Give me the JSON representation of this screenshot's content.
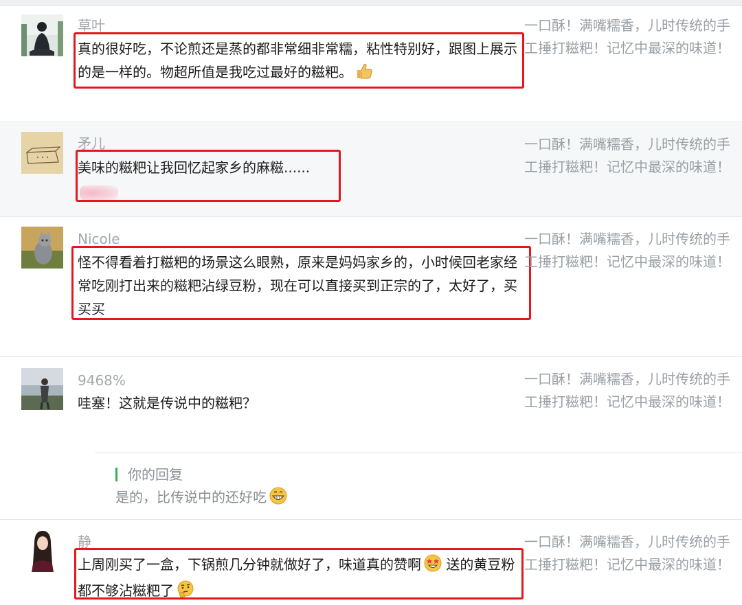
{
  "article_title": "一口酥！满嘴糯香，儿时传统的手工捶打糍粑！记忆中最深的味道！",
  "comments": [
    {
      "nickname": "草叶",
      "avatar_icon": "meditation-silhouette-icon",
      "text": "真的很好吃，不论煎还是蒸的都非常细非常糯，粘性特别好，跟图上展示的是一样的。物超所值是我吃过最好的糍粑。",
      "emoji": "thumbs-up-icon",
      "highlighted": true
    },
    {
      "nickname": "矛儿",
      "avatar_icon": "sketch-box-icon",
      "text": "美味的糍粑让我回忆起家乡的麻糍......",
      "highlighted": true
    },
    {
      "nickname": "Nicole",
      "avatar_icon": "cat-photo-icon",
      "text": "怪不得看着打糍粑的场景这么眼熟，原来是妈妈家乡的，小时候回老家经常吃刚打出来的糍粑沾绿豆粉，现在可以直接买到正宗的了，太好了，买买买",
      "highlighted": true
    },
    {
      "nickname": "9468%",
      "avatar_icon": "person-outdoor-photo-icon",
      "text": "哇塞！这就是传说中的糍粑？",
      "highlighted": false,
      "reply": {
        "label": "你的回复",
        "text": "是的，比传说中的还好吃",
        "emoji": "grinning-face-icon"
      }
    },
    {
      "nickname": "静",
      "avatar_icon": "woman-portrait-icon",
      "text_part1": "上周刚买了一盒，下锅煎几分钟就做好了，味道真的赞啊",
      "emoji1": "star-struck-face-icon",
      "text_part2": " 送的黄豆粉都不够沾糍粑了",
      "emoji2": "thinking-face-icon",
      "highlighted": true
    }
  ],
  "colors": {
    "highlight_border": "#e5161c",
    "reply_accent": "#2fb24a",
    "muted_text": "#9aa0a6",
    "gray_row_bg": "#f6f7f8"
  }
}
